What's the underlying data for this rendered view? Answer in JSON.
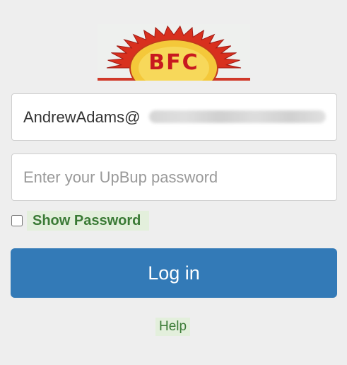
{
  "logo": {
    "text": "BFC",
    "icon": "sun-logo-icon",
    "colors": {
      "sun_rays": "#d8301e",
      "sun_face": "#f4c83a",
      "lettering": "#c8191f"
    }
  },
  "login_form": {
    "email_value": "AndrewAdams@",
    "password_placeholder": "Enter your UpBup password",
    "show_password_label": "Show Password",
    "show_password_checked": false,
    "login_button_label": "Log in",
    "help_label": "Help"
  },
  "colors": {
    "page_background": "#eeeeee",
    "primary_button": "#337ab7",
    "link_text": "#3a7a35",
    "link_highlight": "#e3efdc"
  }
}
